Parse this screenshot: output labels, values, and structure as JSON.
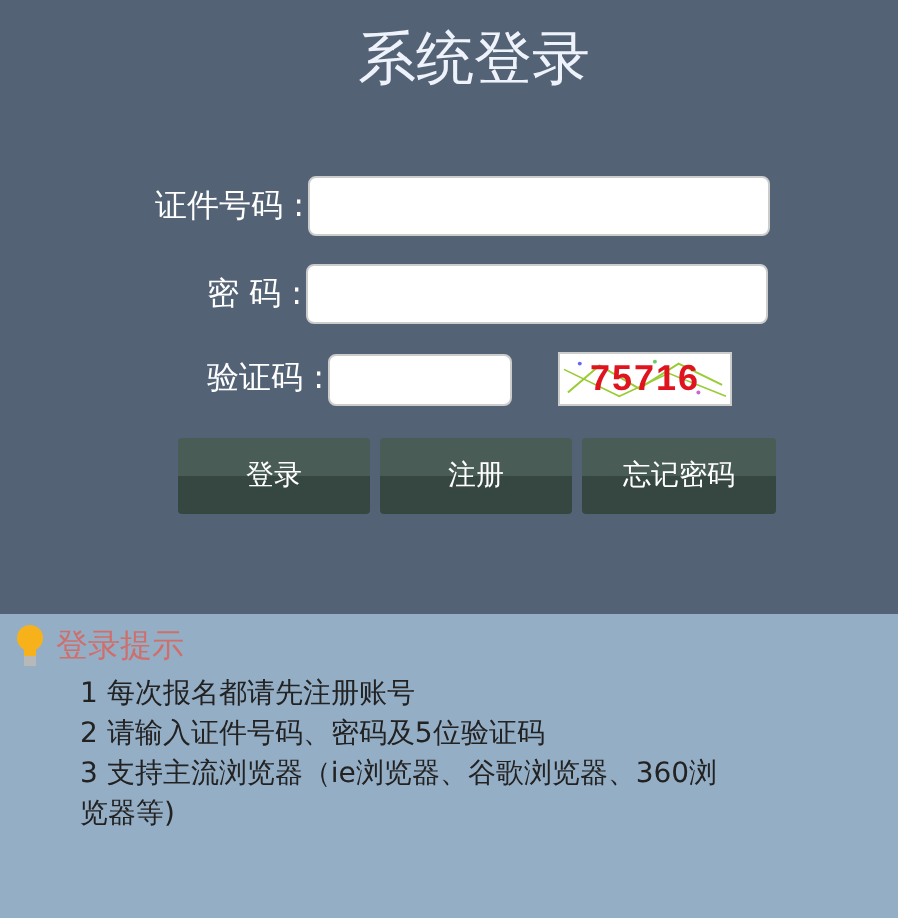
{
  "title": "系统登录",
  "fields": [
    {
      "kind": "text",
      "label": "证件号码 :"
    },
    {
      "kind": "password",
      "label": "密 码 :"
    },
    {
      "kind": "captcha",
      "label": "验证码 :",
      "captcha": "75716"
    }
  ],
  "buttons": [
    "登录",
    "注册",
    "忘记密码"
  ],
  "tips": {
    "heading": "登录提示",
    "items": [
      "1 每次报名都请先注册账号",
      "2 请输入证件号码、密码及5位验证码",
      "3 支持主流浏览器（ie浏览器、谷歌浏览器、360浏览器等)"
    ]
  }
}
